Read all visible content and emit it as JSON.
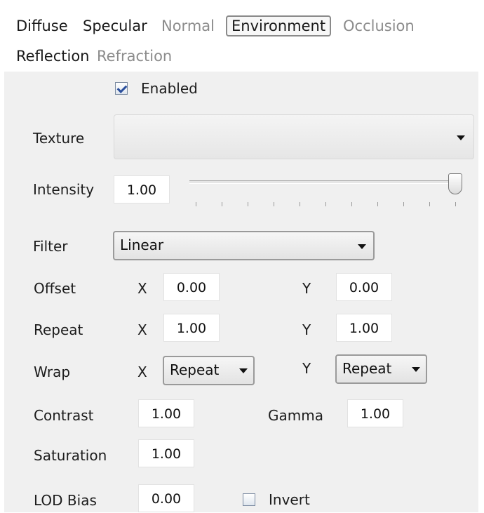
{
  "tabs": [
    {
      "label": "Diffuse",
      "state": "normal"
    },
    {
      "label": "Specular",
      "state": "normal"
    },
    {
      "label": "Normal",
      "state": "disabled"
    },
    {
      "label": "Environment",
      "state": "active"
    },
    {
      "label": "Occlusion",
      "state": "disabled"
    },
    {
      "label": "Reflection",
      "state": "normal"
    },
    {
      "label": "Refraction",
      "state": "disabled"
    }
  ],
  "enabled": {
    "label": "Enabled",
    "checked": true
  },
  "texture": {
    "label": "Texture",
    "value": ""
  },
  "intensity": {
    "label": "Intensity",
    "value": "1.00",
    "slider_level": 1.0
  },
  "filter": {
    "label": "Filter",
    "value": "Linear"
  },
  "offset": {
    "label": "Offset",
    "x_label": "X",
    "x": "0.00",
    "y_label": "Y",
    "y": "0.00"
  },
  "repeat": {
    "label": "Repeat",
    "x_label": "X",
    "x": "1.00",
    "y_label": "Y",
    "y": "1.00"
  },
  "wrap": {
    "label": "Wrap",
    "x_label": "X",
    "x": "Repeat",
    "y_label": "Y",
    "y": "Repeat"
  },
  "contrast": {
    "label": "Contrast",
    "value": "1.00"
  },
  "gamma": {
    "label": "Gamma",
    "value": "1.00"
  },
  "saturation": {
    "label": "Saturation",
    "value": "1.00"
  },
  "lod_bias": {
    "label": "LOD Bias",
    "value": "0.00"
  },
  "invert": {
    "label": "Invert",
    "checked": false
  },
  "colors": {
    "panel": "#f0f0f0",
    "disabled_text": "#8c8c8c",
    "check": "#2b4f9c"
  }
}
